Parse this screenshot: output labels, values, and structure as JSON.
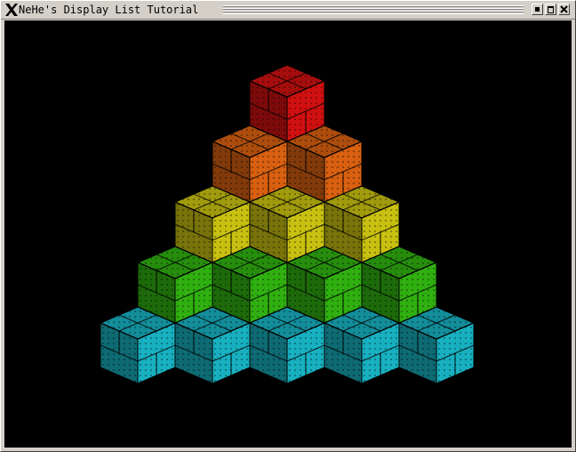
{
  "window": {
    "title": "NeHe's Display List Tutorial",
    "controls": [
      "minimize",
      "maximize",
      "close"
    ]
  },
  "scene": {
    "background": "#000000",
    "shape": "pyramid of textured cubes",
    "rows": [
      {
        "count": 1,
        "color": "#d01010"
      },
      {
        "count": 2,
        "color": "#d86010"
      },
      {
        "count": 3,
        "color": "#c8c010"
      },
      {
        "count": 4,
        "color": "#30b010"
      },
      {
        "count": 5,
        "color": "#18b0c0"
      }
    ]
  }
}
